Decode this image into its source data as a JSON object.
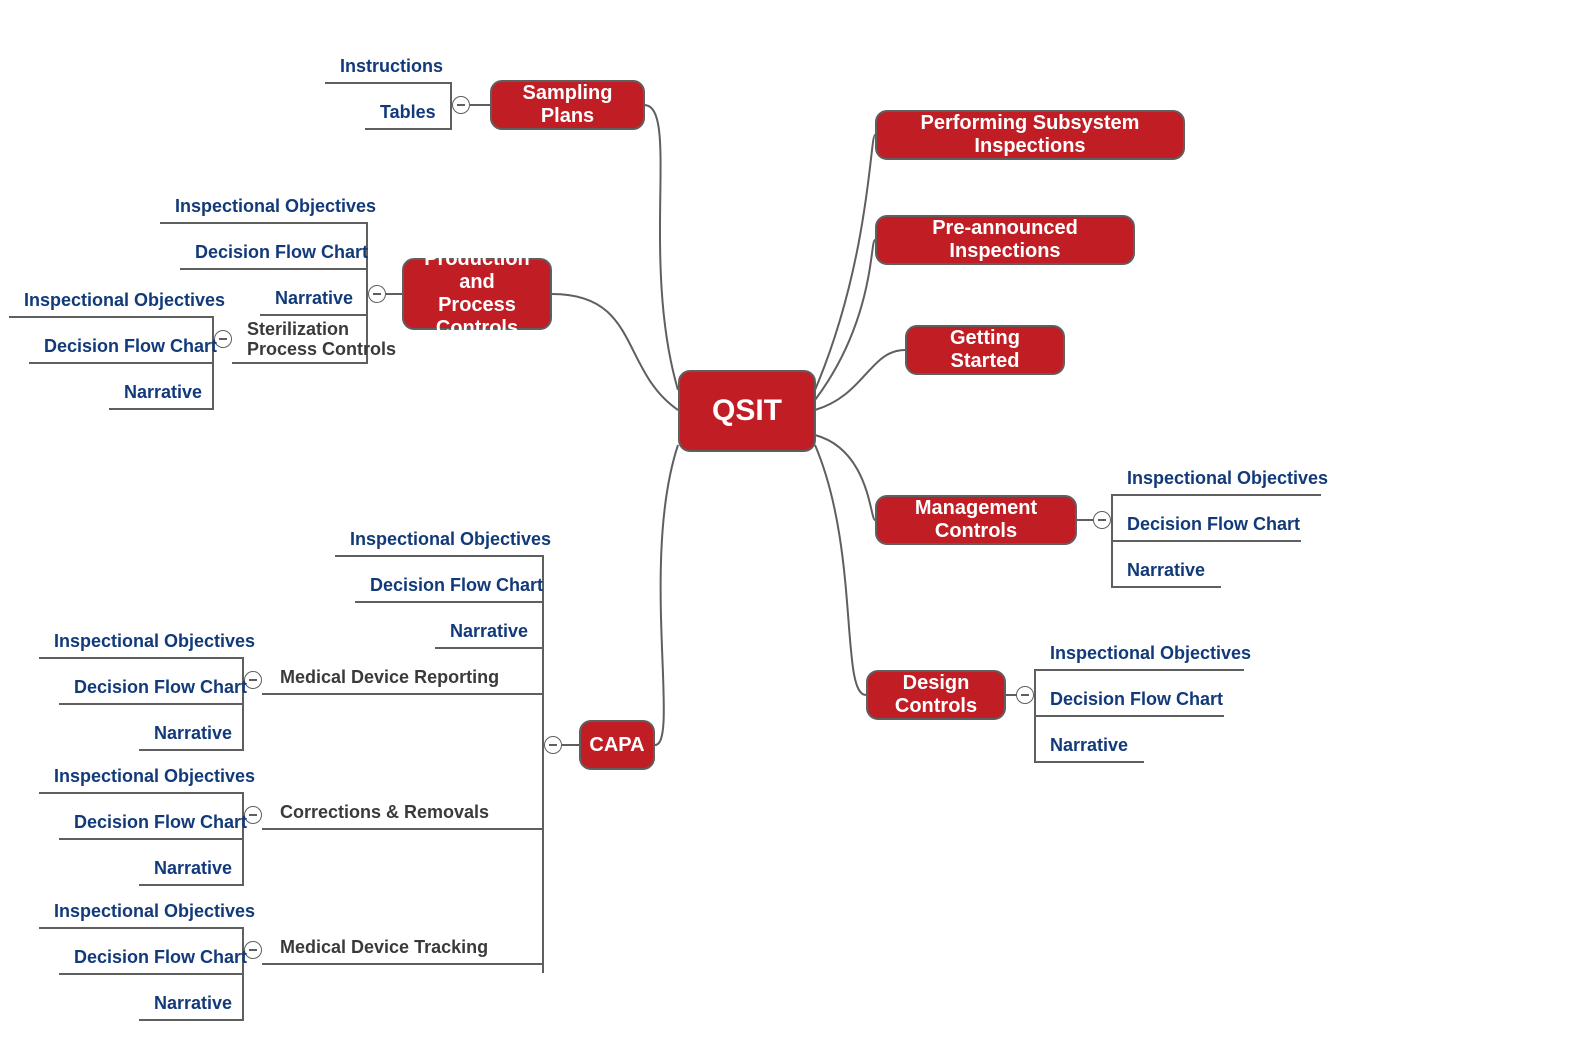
{
  "root": {
    "label": "QSIT"
  },
  "branches": {
    "sampling": {
      "label": "Sampling Plans"
    },
    "ppc": {
      "label": "Production and\nProcess Controls"
    },
    "capa": {
      "label": "CAPA"
    },
    "psi": {
      "label": "Performing Subsystem Inspections"
    },
    "pai": {
      "label": "Pre-announced Inspections"
    },
    "gs": {
      "label": "Getting Started"
    },
    "mc": {
      "label": "Management Controls"
    },
    "dc": {
      "label": "Design Controls"
    }
  },
  "leaves": {
    "sampling_instructions": "Instructions",
    "sampling_tables": "Tables",
    "ppc_io": "Inspectional Objectives",
    "ppc_dfc": "Decision Flow Chart",
    "ppc_narr": "Narrative",
    "ppc_spc": "Sterilization\nProcess Controls",
    "ppc_spc_io": "Inspectional Objectives",
    "ppc_spc_dfc": "Decision Flow Chart",
    "ppc_spc_narr": "Narrative",
    "capa_io": "Inspectional Objectives",
    "capa_dfc": "Decision Flow Chart",
    "capa_narr": "Narrative",
    "capa_mdr": "Medical Device Reporting",
    "capa_mdr_io": "Inspectional Objectives",
    "capa_mdr_dfc": "Decision Flow Chart",
    "capa_mdr_narr": "Narrative",
    "capa_cr": "Corrections & Removals",
    "capa_cr_io": "Inspectional Objectives",
    "capa_cr_dfc": "Decision Flow Chart",
    "capa_cr_narr": "Narrative",
    "capa_mdt": "Medical Device Tracking",
    "capa_mdt_io": "Inspectional Objectives",
    "capa_mdt_dfc": "Decision Flow Chart",
    "capa_mdt_narr": "Narrative",
    "mc_io": "Inspectional Objectives",
    "mc_dfc": "Decision Flow Chart",
    "mc_narr": "Narrative",
    "dc_io": "Inspectional Objectives",
    "dc_dfc": "Decision Flow Chart",
    "dc_narr": "Narrative"
  },
  "colors": {
    "brand": "#c11d25",
    "text": "#123a7a",
    "line": "#5f5f5f"
  }
}
